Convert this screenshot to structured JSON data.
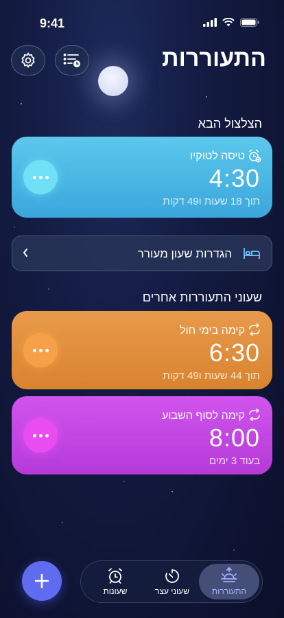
{
  "status": {
    "time": "9:41"
  },
  "header": {
    "title": "התעוררות"
  },
  "next_alarm_section": {
    "label": "הצלצול הבא"
  },
  "next_alarm": {
    "name": "טיסה לטוקיו",
    "time": "4:30",
    "subtitle": "תוך 18 שעות ו49 דקות",
    "color_top": "#5cc8ec",
    "color_bottom": "#3aa6dc"
  },
  "sleep_settings": {
    "label": "הגדרות שעון מעורר"
  },
  "other_alarms_section": {
    "label": "שעוני התעוררות אחרים"
  },
  "alarms": [
    {
      "name": "קימה בימי חול",
      "time": "6:30",
      "subtitle": "תוך 44 שעות ו49 דקות",
      "color": "#e08a3a"
    },
    {
      "name": "קימה לסוף השבוע",
      "time": "8:00",
      "subtitle": "בעוד 3 ימים",
      "color": "#c43fe0"
    }
  ],
  "tabs": [
    {
      "label": "שעונות",
      "icon": "alarm-clock-icon"
    },
    {
      "label": "שעוני עצר",
      "icon": "timer-icon"
    },
    {
      "label": "התעוררות",
      "icon": "sunrise-icon",
      "active": true
    }
  ]
}
